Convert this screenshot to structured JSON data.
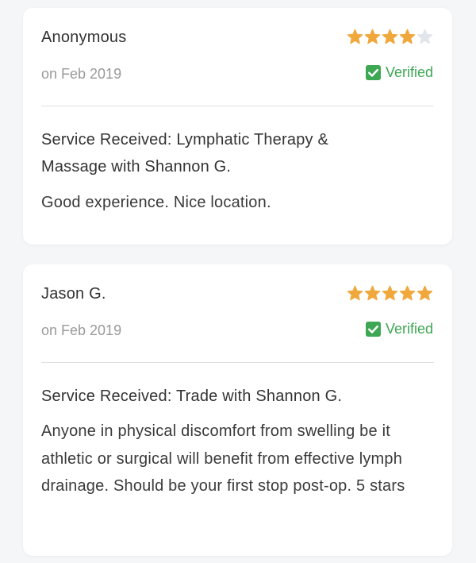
{
  "colors": {
    "star_filled": "#F0A83C",
    "star_empty": "#E2E5EA",
    "verified_green": "#3EA753",
    "divider": "#E0E0E0",
    "background": "#F5F6F8"
  },
  "reviews": [
    {
      "name": "Anonymous",
      "rating": 4,
      "rating_max": 5,
      "date": "on Feb 2019",
      "verified_label": "Verified",
      "service": "Service Received: Lymphatic Therapy & Massage with Shannon G.",
      "comment": "Good experience. Nice location."
    },
    {
      "name": "Jason G.",
      "rating": 5,
      "rating_max": 5,
      "date": "on Feb 2019",
      "verified_label": "Verified",
      "service": "Service Received: Trade with Shannon G.",
      "comment": "Anyone in physical discomfort from swelling be it athletic or surgical will benefit from effective lymph drainage. Should be your first stop post-op. 5 stars"
    }
  ]
}
